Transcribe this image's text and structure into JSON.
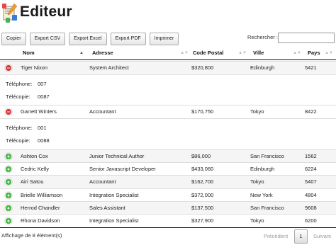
{
  "header": {
    "title": "Editeur"
  },
  "toolbar": {
    "buttons": [
      "Copier",
      "Export CSV",
      "Export Excel",
      "Export PDF",
      "Imprimer"
    ]
  },
  "search": {
    "label": "Rechercher :",
    "value": ""
  },
  "table": {
    "columns": [
      "Nom",
      "Adresse",
      "Code Postal",
      "Ville",
      "Pays"
    ],
    "rows": [
      {
        "name": "Tiger Nixon",
        "adresse": "System Architect",
        "code": "$320,800",
        "ville": "Edinburgh",
        "pays": "5421",
        "expanded": true
      },
      {
        "name": "Garrett Winters",
        "adresse": "Accountant",
        "code": "$170,750",
        "ville": "Tokyo",
        "pays": "8422",
        "expanded": true
      },
      {
        "name": "Ashton Cox",
        "adresse": "Junior Technical Author",
        "code": "$86,000",
        "ville": "San Francisco",
        "pays": "1562",
        "expanded": false
      },
      {
        "name": "Cedric Kelly",
        "adresse": "Senior Javascript Developer",
        "code": "$433,060",
        "ville": "Edinburgh",
        "pays": "6224",
        "expanded": false
      },
      {
        "name": "Airi Satou",
        "adresse": "Accountant",
        "code": "$162,700",
        "ville": "Tokyo",
        "pays": "5407",
        "expanded": false
      },
      {
        "name": "Brielle Williamson",
        "adresse": "Integration Specialist",
        "code": "$372,000",
        "ville": "New York",
        "pays": "4804",
        "expanded": false
      },
      {
        "name": "Herrod Chandler",
        "adresse": "Sales Assistant",
        "code": "$137,500",
        "ville": "San Francisco",
        "pays": "9608",
        "expanded": false
      },
      {
        "name": "Rhona Davidson",
        "adresse": "Integration Specialist",
        "code": "$327,900",
        "ville": "Tokyo",
        "pays": "6200",
        "expanded": false
      }
    ],
    "details": [
      {
        "tel_label": "Téléphone:",
        "tel": "007",
        "fax_label": "Télécopie:",
        "fax": "0087"
      },
      {
        "tel_label": "Téléphone:",
        "tel": "001",
        "fax_label": "Télécopie:",
        "fax": "0088"
      }
    ]
  },
  "footer": {
    "info": "Affichage de 8 élément(s)",
    "prev": "Précédent",
    "page": "1",
    "next": "Suivant"
  },
  "colors": {
    "open_control": "#d33333",
    "closed_control": "#31b131",
    "stripe": "#f5f5f5"
  },
  "icons": {
    "app": "document-edit-icon",
    "open": "minus-circle-icon",
    "closed": "plus-circle-icon"
  }
}
